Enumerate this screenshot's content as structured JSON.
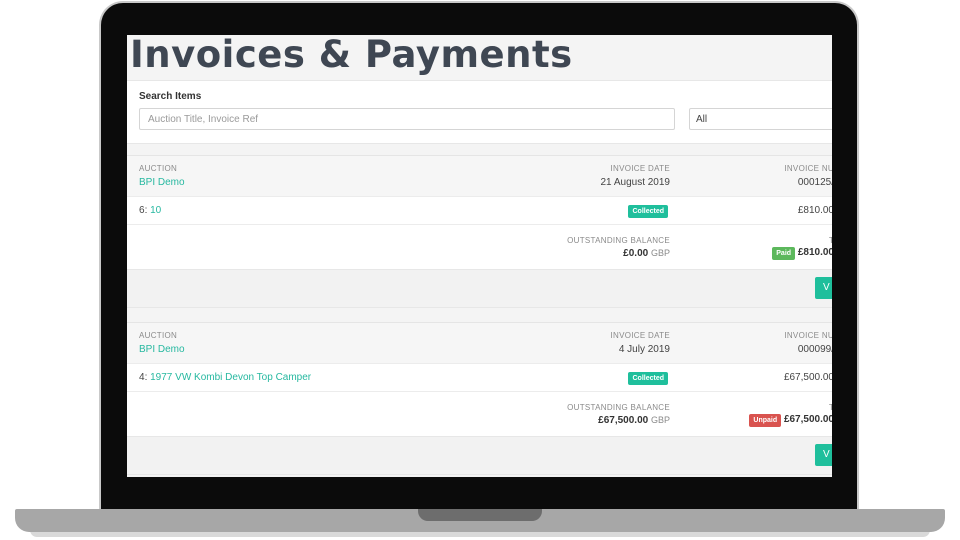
{
  "page": {
    "title": "Invoices & Payments"
  },
  "search": {
    "label": "Search Items",
    "placeholder": "Auction Title, Invoice Ref",
    "filter_value": "All"
  },
  "columns": {
    "auction": "AUCTION",
    "invoice_date": "INVOICE DATE",
    "invoice_number": "INVOICE NU",
    "outstanding_balance": "OUTSTANDING BALANCE",
    "total": "T"
  },
  "invoices": [
    {
      "auction": "BPI Demo",
      "invoice_date": "21 August 2019",
      "invoice_number": "000125/",
      "lot_number": "6",
      "lot_title": "10",
      "item_status": "Collected",
      "item_amount": "£810.00",
      "balance": "£0.00",
      "currency": "GBP",
      "payment_status": "Paid",
      "total": "£810.00",
      "action_label": "V"
    },
    {
      "auction": "BPI Demo",
      "invoice_date": "4 July 2019",
      "invoice_number": "000099/",
      "lot_number": "4",
      "lot_title": "1977 VW Kombi Devon Top Camper",
      "item_status": "Collected",
      "item_amount": "£67,500.00",
      "balance": "£67,500.00",
      "currency": "GBP",
      "payment_status": "Unpaid",
      "total": "£67,500.00",
      "action_label": "V"
    }
  ],
  "colors": {
    "accent": "#1fbf9c",
    "link": "#26b8a0",
    "paid": "#5cb85c",
    "unpaid": "#d9534f",
    "title": "#3f4753"
  }
}
